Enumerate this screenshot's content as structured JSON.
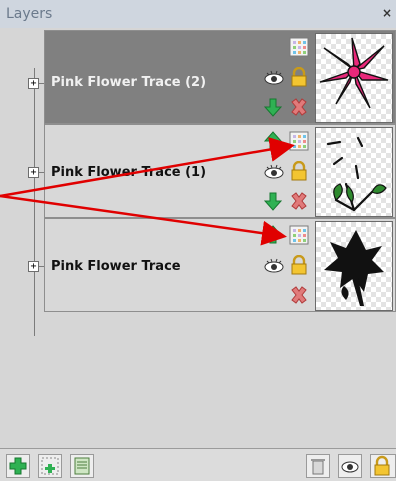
{
  "panel": {
    "title": "Layers",
    "close_glyph": "×"
  },
  "layers": [
    {
      "name": "Pink Flower Trace (2)",
      "selected": true,
      "expander": "+",
      "thumbnail": "pink-flower"
    },
    {
      "name": "Pink Flower Trace (1)",
      "selected": false,
      "expander": "+",
      "thumbnail": "flower-line-sketch"
    },
    {
      "name": "Pink Flower Trace",
      "selected": false,
      "expander": "+",
      "thumbnail": "black-flower-silhouette"
    }
  ],
  "icons": {
    "grid": "grid-icon",
    "eye": "eye-icon",
    "lock": "padlock-icon",
    "up": "move-up-arrow-icon",
    "down": "move-down-arrow-icon",
    "delete": "delete-x-icon"
  },
  "bottom_toolbar": [
    "add-layer-button",
    "add-child-layer-button",
    "layer-properties-button",
    "trash-button",
    "eye-toggle-button",
    "lock-toggle-button"
  ],
  "colors": {
    "selected_row": "#808080",
    "normal_row": "#d8d8d8",
    "arrow_annotation": "#e00000",
    "flower_pink": "#e8287a",
    "up_arrow": "#1ba84a"
  }
}
